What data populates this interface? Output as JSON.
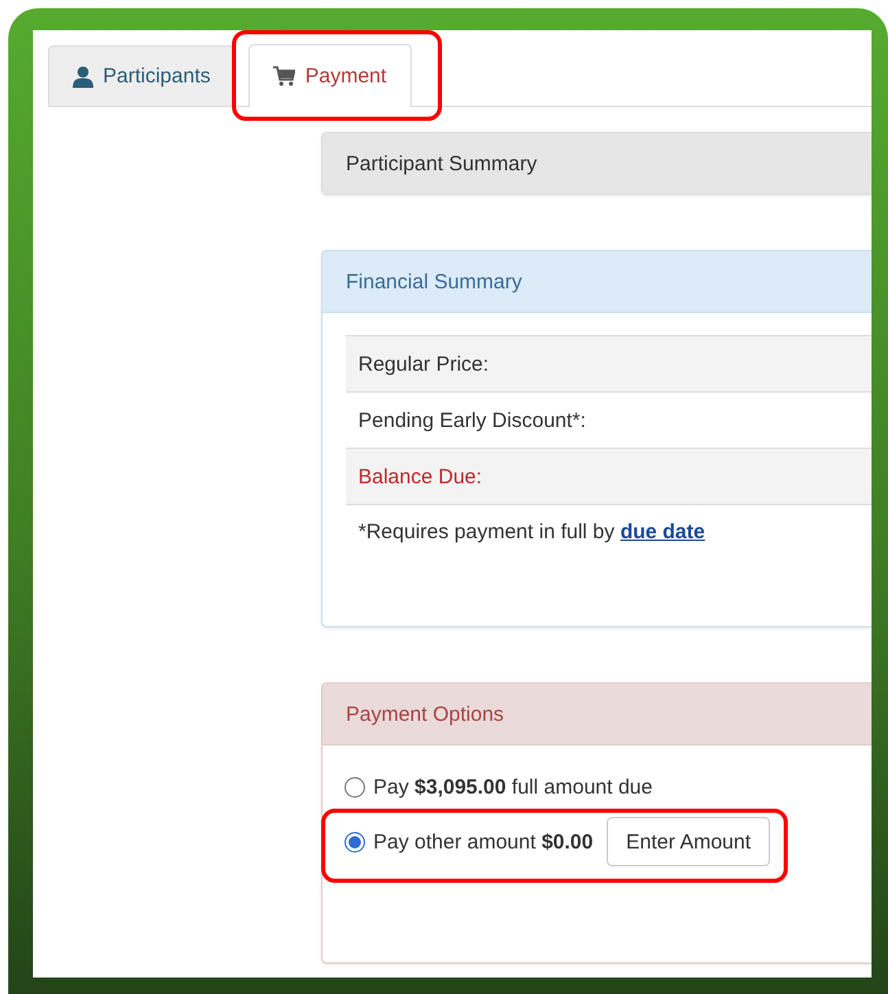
{
  "tabs": [
    {
      "label": "Participants",
      "selected": false,
      "highlighted": false
    },
    {
      "label": "Payment",
      "selected": true,
      "highlighted": true
    }
  ],
  "participant_summary": {
    "title": "Participant Summary"
  },
  "financial_summary": {
    "title": "Financial Summary",
    "rows": [
      {
        "label": "Regular Price:",
        "kind": "normal"
      },
      {
        "label": "Pending Early Discount*:",
        "kind": "normal"
      },
      {
        "label": "Balance Due:",
        "kind": "due"
      }
    ],
    "note": "*Requires payment in full by",
    "note_link": "due date"
  },
  "payment_options": {
    "title": "Payment Options",
    "options": [
      {
        "label": "Pay **$3,095.00** full amount due",
        "selected": false,
        "highlighted": false
      },
      {
        "label": "Pay other amount **$0.00**",
        "selected": true,
        "highlighted": true,
        "button": "Enter Amount"
      }
    ]
  }
}
